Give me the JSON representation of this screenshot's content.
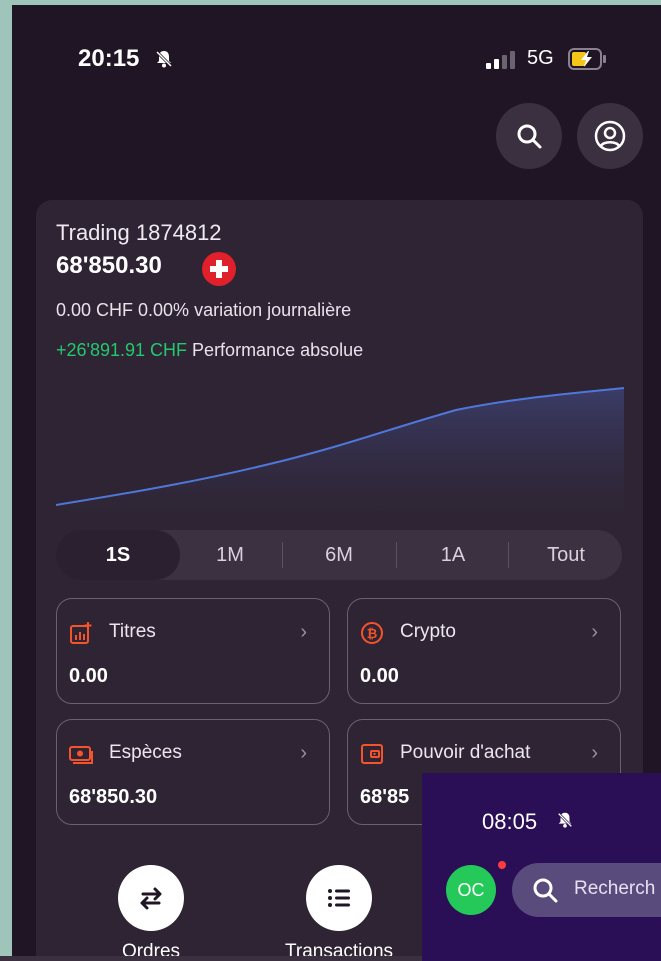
{
  "status": {
    "time": "20:15",
    "network": "5G"
  },
  "account": {
    "name": "Trading 1874812",
    "balance": "68'850.30",
    "daily_change_value": "0.00 CHF 0.00%",
    "daily_change_label": "variation journalière",
    "abs_perf_value": "+26'891.91 CHF",
    "abs_perf_label": "Performance absolue"
  },
  "tabs": [
    "1S",
    "1M",
    "6M",
    "1A",
    "Tout"
  ],
  "tiles": [
    {
      "label": "Titres",
      "value": "0.00"
    },
    {
      "label": "Crypto",
      "value": "0.00"
    },
    {
      "label": "Espèces",
      "value": "68'850.30"
    },
    {
      "label": "Pouvoir d'achat",
      "value": "68'85"
    }
  ],
  "actions": [
    {
      "label": "Ordres"
    },
    {
      "label": "Transactions"
    }
  ],
  "overlay": {
    "time": "08:05",
    "avatar": "OC",
    "search_text": "Recherch"
  },
  "colors": {
    "background": "#201524",
    "card": "#2e2433",
    "accent": "#23c96d",
    "icon_orange": "#f5542a",
    "line": "#4f77d9"
  },
  "icons": [
    "search-icon",
    "profile-icon",
    "bell-muted-icon",
    "chart-plus-icon",
    "bitcoin-icon",
    "cash-icon",
    "wallet-icon",
    "swap-icon",
    "list-icon"
  ]
}
